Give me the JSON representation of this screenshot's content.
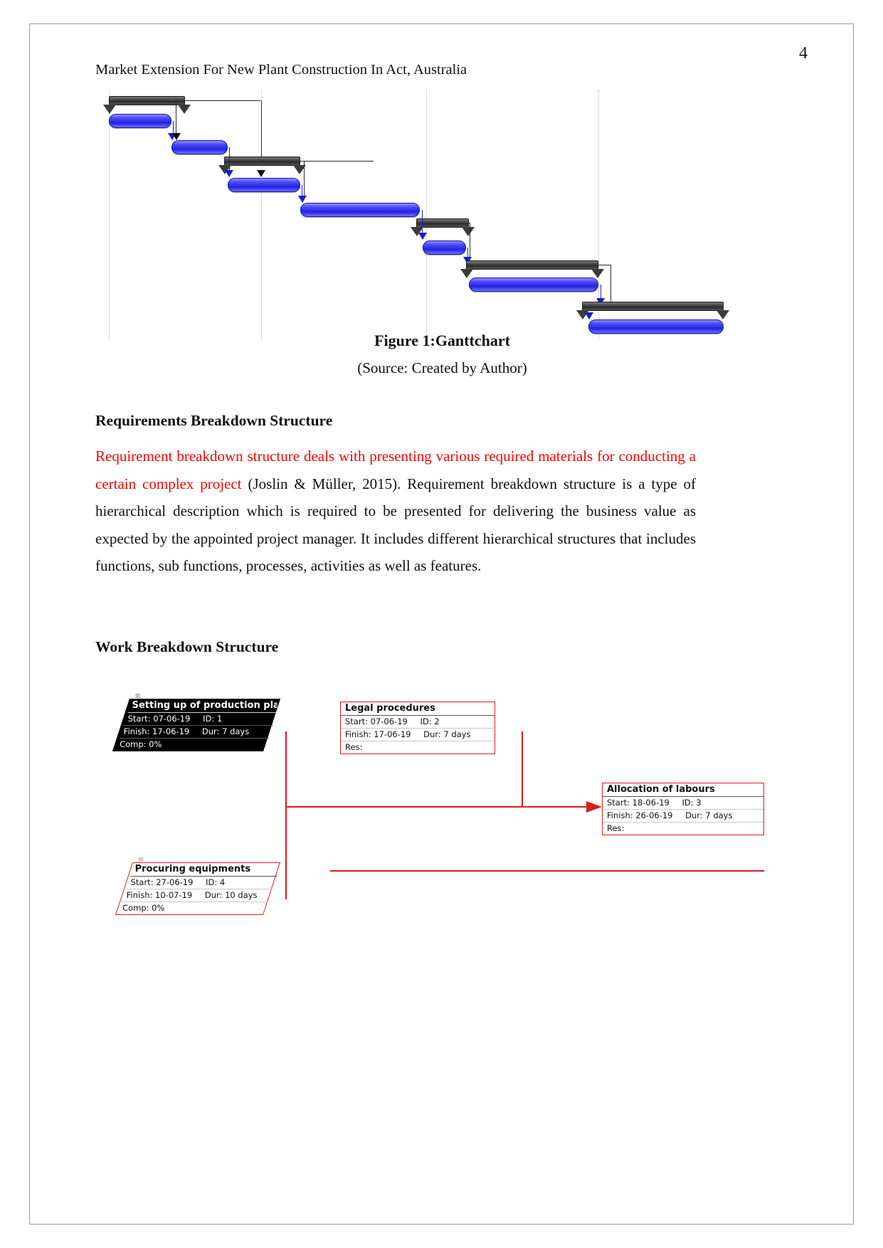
{
  "document": {
    "page_number": "4",
    "running_head": "Market Extension For New Plant Construction In Act, Australia"
  },
  "figure": {
    "caption": "Figure 1:Ganttchart",
    "source": "(Source: Created by Author)"
  },
  "sections": [
    {
      "heading": "Requirements Breakdown Structure",
      "paragraph_red": "Requirement breakdown structure deals with presenting various required materials for conducting a certain complex project",
      "paragraph_black": " (Joslin & Müller, 2015). Requirement breakdown structure is a type of hierarchical description which is required to be presented for delivering the business value as expected by the appointed project manager. It includes different hierarchical structures that includes functions, sub functions, processes, activities as well as features."
    },
    {
      "heading": "Work Breakdown Structure"
    }
  ],
  "chart_data": {
    "type": "bar",
    "title": "Figure 1:Ganttchart",
    "xlabel": "",
    "ylabel": "",
    "grid": true,
    "legend": "none",
    "bars": [
      {
        "name": "summary-1",
        "kind": "summary",
        "row": 0,
        "start_pct": 2.0,
        "end_pct": 13.5
      },
      {
        "name": "task-1",
        "kind": "task",
        "row": 1,
        "start_pct": 2.0,
        "end_pct": 11.5
      },
      {
        "name": "task-2",
        "kind": "task",
        "row": 2,
        "start_pct": 11.5,
        "end_pct": 20.0
      },
      {
        "name": "summary-2",
        "kind": "summary",
        "row": 3,
        "start_pct": 19.5,
        "end_pct": 31.0
      },
      {
        "name": "task-3",
        "kind": "task",
        "row": 4,
        "start_pct": 20.0,
        "end_pct": 31.0
      },
      {
        "name": "task-4",
        "kind": "task",
        "row": 5,
        "start_pct": 31.0,
        "end_pct": 49.0
      },
      {
        "name": "summary-3",
        "kind": "summary",
        "row": 6,
        "start_pct": 48.5,
        "end_pct": 56.5
      },
      {
        "name": "task-5",
        "kind": "task",
        "row": 7,
        "start_pct": 49.5,
        "end_pct": 56.0
      },
      {
        "name": "summary-4",
        "kind": "summary",
        "row": 8,
        "start_pct": 56.0,
        "end_pct": 76.0
      },
      {
        "name": "task-6",
        "kind": "task",
        "row": 9,
        "start_pct": 56.5,
        "end_pct": 76.0
      },
      {
        "name": "summary-5",
        "kind": "summary",
        "row": 10,
        "start_pct": 73.5,
        "end_pct": 95.0
      },
      {
        "name": "task-7",
        "kind": "task",
        "row": 11,
        "start_pct": 74.5,
        "end_pct": 95.0
      }
    ],
    "gridlines_pct": [
      2.0,
      25.0,
      50.0,
      76.0
    ],
    "colors": {
      "task": "#3232f0",
      "summary": "#333333",
      "gridline": "#b8b8b8"
    }
  },
  "wbs": {
    "accent_color": "#e01b1b",
    "nodes": [
      {
        "id": "node-1",
        "title": "Setting up of production plant",
        "start_label": "Start:",
        "start": "07-06-19",
        "id_label": "ID:",
        "id_value": "1",
        "finish_label": "Finish:",
        "finish": "17-06-19",
        "dur_label": "Dur:",
        "dur": "7 days",
        "last_label": "Comp:",
        "last_value": "0%",
        "style": "dark-skewed"
      },
      {
        "id": "node-2",
        "title": "Legal procedures",
        "start_label": "Start:",
        "start": "07-06-19",
        "id_label": "ID:",
        "id_value": "2",
        "finish_label": "Finish:",
        "finish": "17-06-19",
        "dur_label": "Dur:",
        "dur": "7 days",
        "last_label": "Res:",
        "last_value": "",
        "style": "light-rect"
      },
      {
        "id": "node-3",
        "title": "Allocation of labours",
        "start_label": "Start:",
        "start": "18-06-19",
        "id_label": "ID:",
        "id_value": "3",
        "finish_label": "Finish:",
        "finish": "26-06-19",
        "dur_label": "Dur:",
        "dur": "7 days",
        "last_label": "Res:",
        "last_value": "",
        "style": "light-rect"
      },
      {
        "id": "node-4",
        "title": "Procuring equipments",
        "start_label": "Start:",
        "start": "27-06-19",
        "id_label": "ID:",
        "id_value": "4",
        "finish_label": "Finish:",
        "finish": "10-07-19",
        "dur_label": "Dur:",
        "dur": "10 days",
        "last_label": "Comp:",
        "last_value": "0%",
        "style": "light-skewed"
      }
    ]
  }
}
